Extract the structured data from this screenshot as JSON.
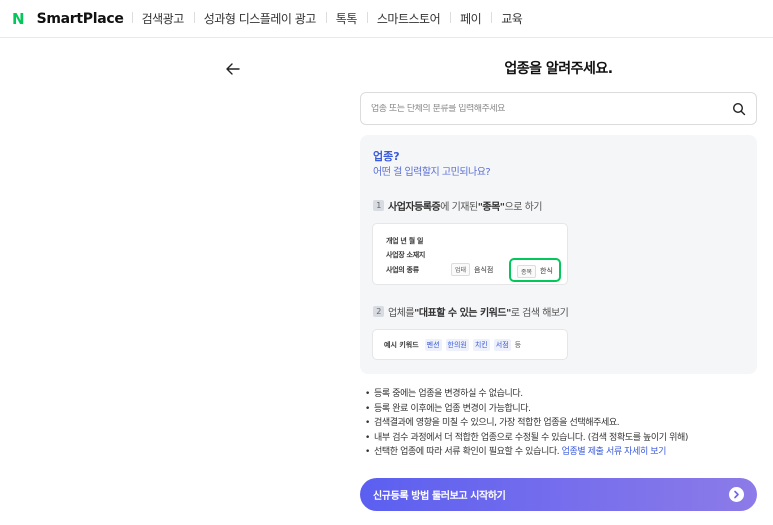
{
  "header": {
    "logo_mark": "N",
    "logo_text": "SmartPlace",
    "nav": [
      "검색광고",
      "성과형 디스플레이 광고",
      "톡톡",
      "스마트스토어",
      "페이",
      "교육"
    ]
  },
  "main": {
    "title": "업종을 알려주세요.",
    "search": {
      "placeholder": "업종 또는 단체의 분류를 입력해주세요",
      "value": ""
    },
    "help": {
      "heading": "업종?",
      "subheading": "어떤 걸 입력할지 고민되나요?",
      "step1": {
        "num": "1",
        "bold": "사업자등록증",
        "text1": "에 기재된 ",
        "quoted": "\"종목\"",
        "text2": "으로 하기"
      },
      "card1": {
        "row1": "개업 년 월 일",
        "row2": "사업장 소재지",
        "row3": "사업의 종류",
        "tag_up": "업태",
        "up_value": "음식점",
        "tag_jong": "종목",
        "jong_value": "한식"
      },
      "step2": {
        "num": "2",
        "text1": "업체를 ",
        "quoted": "\"대표할 수 있는 키워드\"",
        "text2": "로 검색 해보기"
      },
      "card2": {
        "label": "예시 키워드",
        "keywords": [
          "펜션",
          "한의원",
          "치킨",
          "서점"
        ],
        "etc": "등"
      }
    },
    "notes": [
      "등록 중에는 업종을 변경하실 수 없습니다.",
      "등록 완료 이후에는 업종 변경이 가능합니다.",
      "검색결과에 영향을 미칠 수 있으니, 가장 적합한 업종을 선택해주세요.",
      "내부 검수 과정에서 더 적합한 업종으로 수정될 수 있습니다. (검색 정확도를 높이기 위해)",
      "선택한 업종에 따라 서류 확인이 필요할 수 있습니다."
    ],
    "notes_link": "업종별 제출 서류 자세히 보기",
    "cta_label": "신규등록 방법 둘러보고 시작하기"
  },
  "colors": {
    "brand_green": "#03c75a",
    "accent_blue": "#3b5bdb",
    "cta_purple": "#6b66ee"
  }
}
